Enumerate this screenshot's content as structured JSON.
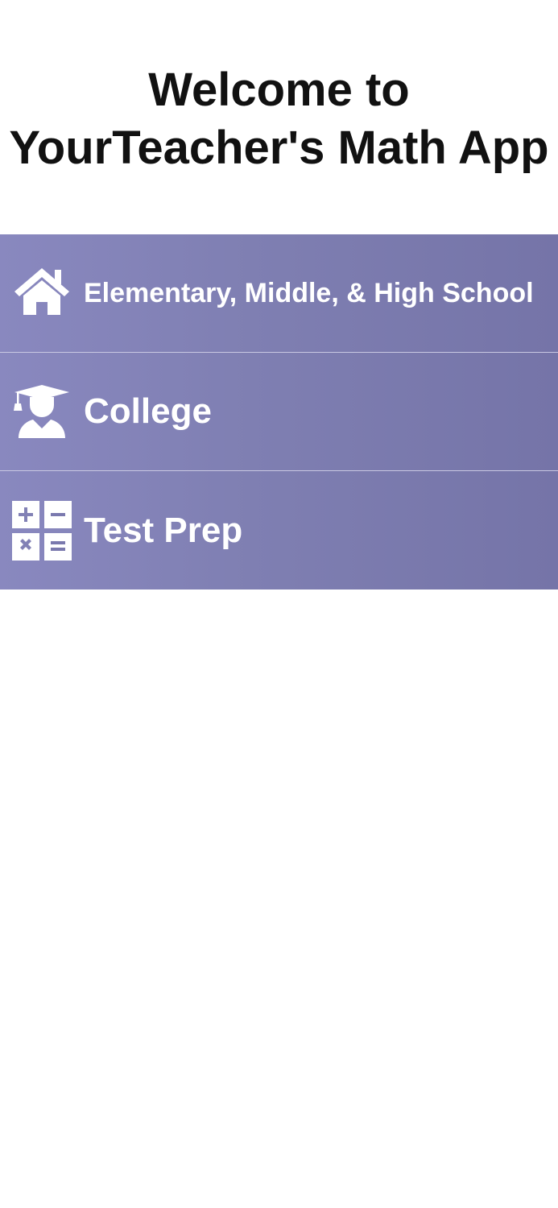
{
  "header": {
    "title_line1": "Welcome to",
    "title_line2": "YourTeacher's Math App"
  },
  "menu": {
    "items": [
      {
        "label": "Elementary, Middle, & High School",
        "icon": "house-icon"
      },
      {
        "label": "College",
        "icon": "graduate-icon"
      },
      {
        "label": "Test Prep",
        "icon": "calculator-icon"
      }
    ]
  },
  "colors": {
    "menu_gradient_start": "#8988bf",
    "menu_gradient_end": "#7574a8",
    "menu_text": "#ffffff",
    "title_text": "#111111",
    "background": "#ffffff"
  }
}
